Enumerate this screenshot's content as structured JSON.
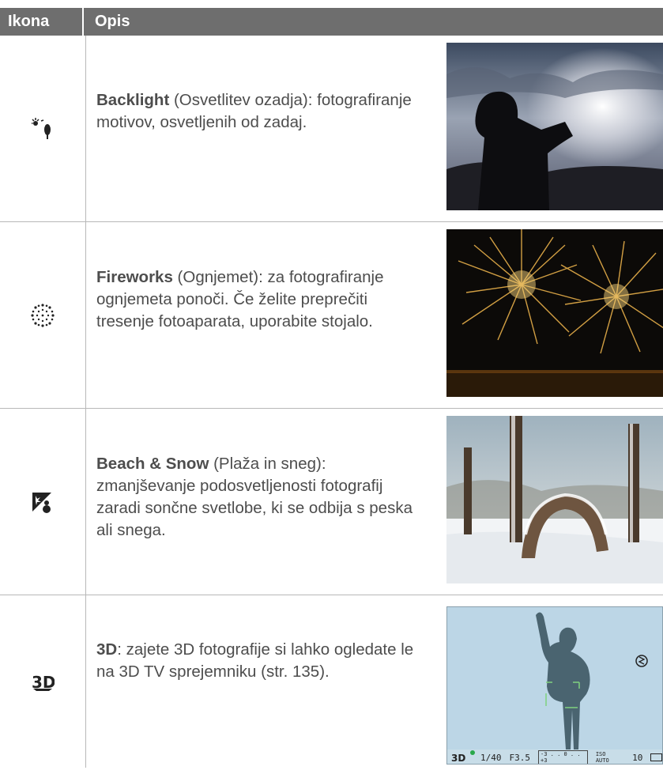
{
  "header": {
    "col_icon": "Ikona",
    "col_desc": "Opis"
  },
  "rows": [
    {
      "icon": "backlight-icon",
      "title": "Backlight",
      "text": " (Osvetlitev ozadja): fotografiranje motivov, osvetljenih od zadaj."
    },
    {
      "icon": "fireworks-icon",
      "title": "Fireworks",
      "text": " (Ognjemet): za fotografiranje ognjemeta ponoči. Če želite preprečiti tresenje fotoaparata, uporabite stojalo."
    },
    {
      "icon": "beach-snow-icon",
      "title": "Beach & Snow",
      "text": " (Plaža in sneg): zmanjševanje podosvetljenosti fotografij zaradi sončne svetlobe, ki se odbija s peska ali snega."
    },
    {
      "icon": "3d-icon",
      "title": "3D",
      "text": ": zajete 3D fotografije si lahko ogledate le na 3D TV sprejemniku (str. 135)."
    }
  ],
  "lcd": {
    "shutter": "1/40",
    "aperture": "F3.5",
    "scale": "-3 . . 0 . . +3",
    "iso": "ISO AUTO",
    "shots": "10"
  },
  "colors": {
    "header_bg": "#6e6e6e",
    "grid": "#b8b8b8",
    "lcd_bg": "#bcd6e6",
    "silhouette": "#4a6470"
  }
}
